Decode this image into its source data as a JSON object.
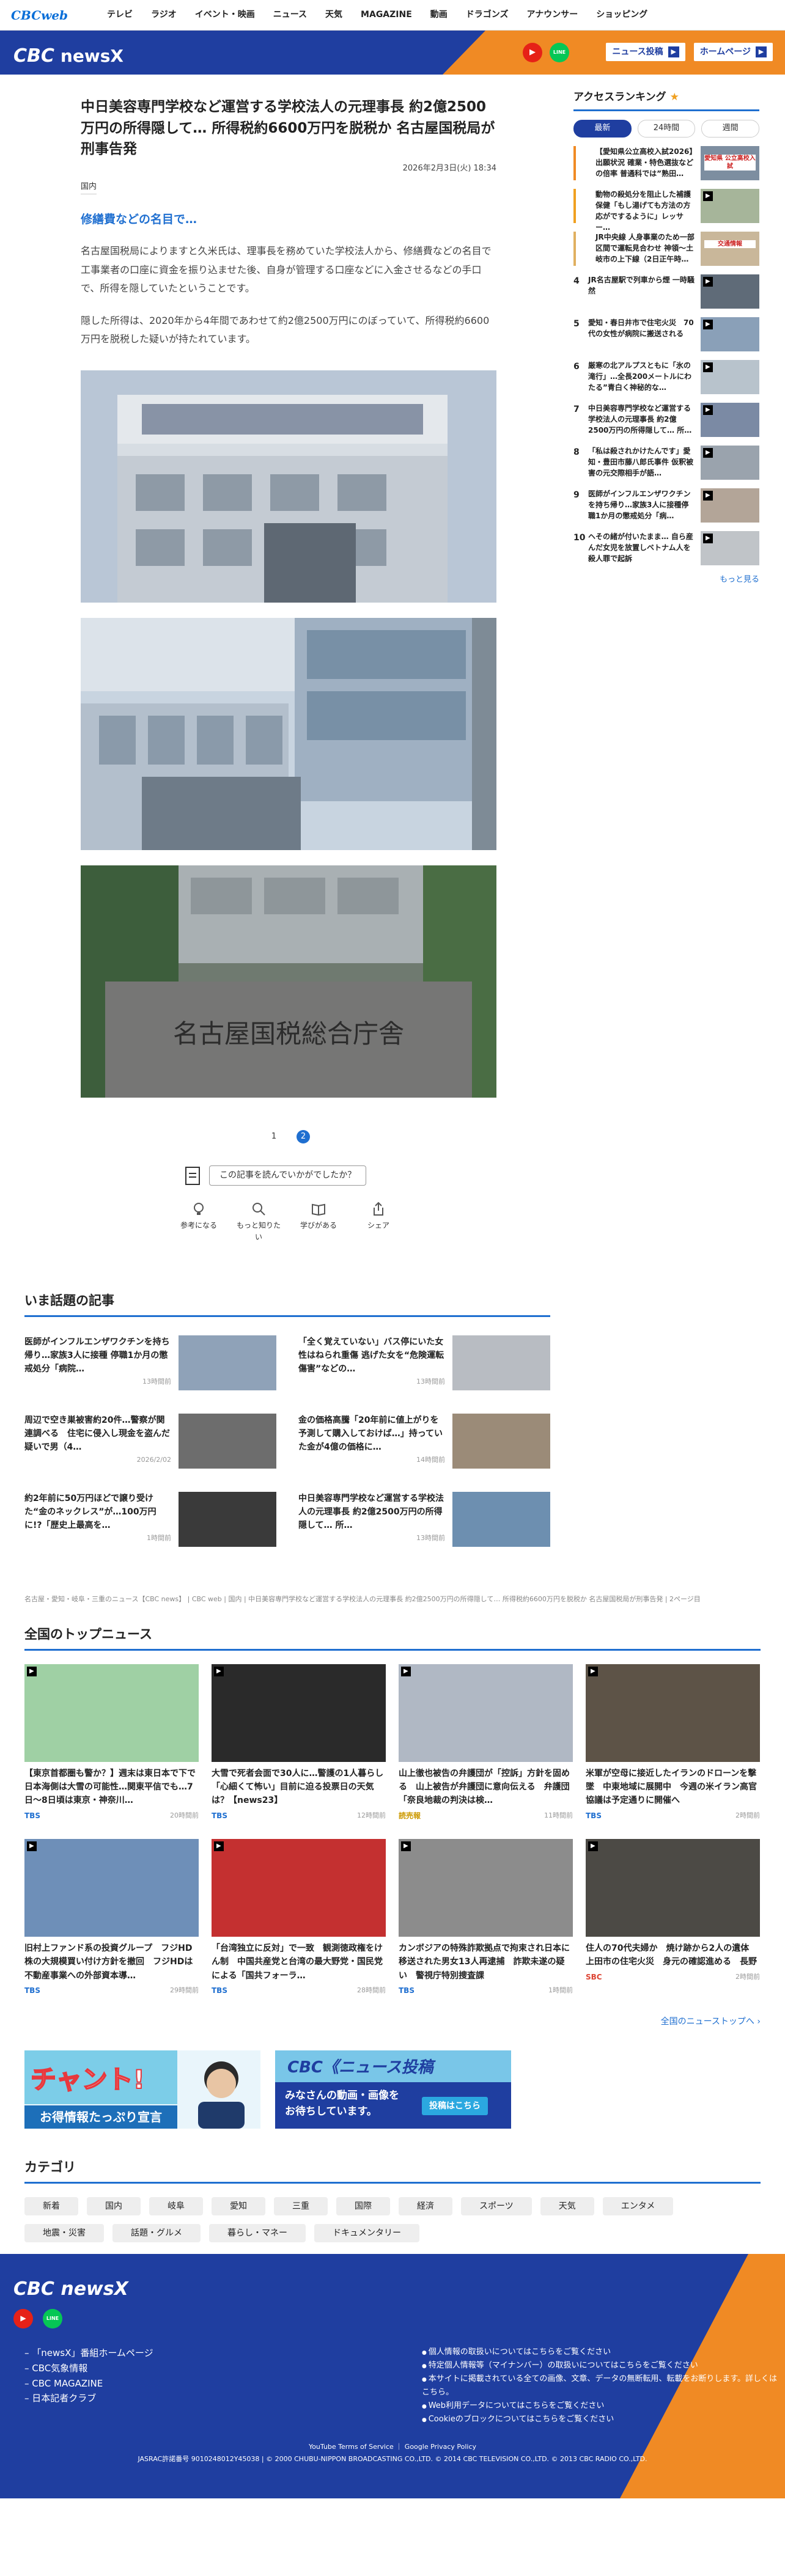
{
  "topnav": {
    "logo": "CBCweb",
    "items": [
      "テレビ",
      "ラジオ",
      "イベント・映画",
      "ニュース",
      "天気",
      "MAGAZINE",
      "動画",
      "ドラゴンズ",
      "アナウンサー",
      "ショッピング"
    ]
  },
  "header": {
    "logo": "CBC",
    "logo_sub": "newsX",
    "post_label": "ニュース投稿",
    "home_label": "ホームページ",
    "youtube": "▶",
    "line": "LINE"
  },
  "article": {
    "title": "中日美容専門学校など運営する学校法人の元理事長 約2億2500万円の所得隠して… 所得税約6600万円を脱税か 名古屋国税局が刑事告発",
    "date": "2026年2月3日(火) 18:34",
    "category": "国内",
    "subhead": "修繕費などの名目で…",
    "para1": "名古屋国税局によりますと久米氏は、理事長を務めていた学校法人から、修繕費などの名目で工事業者の口座に資金を振り込ませた後、自身が管理する口座などに入金させるなどの手口で、所得を隠していたということです。",
    "para2": "隠した所得は、2020年から4年間であわせて約2億2500万円にのぼっていて、所得税約6600万円を脱税した疑いが持たれています。",
    "photo3_text": "名古屋国税総合庁舎"
  },
  "pager": [
    "1",
    "2"
  ],
  "survey": {
    "question": "この記事を読んでいかがでしたか？",
    "reactions": [
      "参考になる",
      "もっと知りたい",
      "学びがある",
      "シェア"
    ]
  },
  "wadai": {
    "heading": "いま話題の記事",
    "items": [
      {
        "title": "医師がインフルエンザワクチンを持ち帰り…家族3人に接種 停職1か月の懲戒処分「病院…",
        "time": "13時間前"
      },
      {
        "title": "「全く覚えていない」バス停にいた女性はねられ重傷 逃げた女を“危険運転傷害”などの…",
        "time": "13時間前"
      },
      {
        "title": "周辺で空き巣被害約20件…警察が関連調べる　住宅に侵入し現金を盗んだ疑いで男（4…",
        "time": "2026/2/02"
      },
      {
        "title": "金の価格高騰「20年前に値上がりを予測して購入しておけば…」持っていた金が4億の価格に…",
        "time": "14時間前"
      },
      {
        "title": "約2年前に50万円ほどで譲り受けた“金のネックレス”が…100万円に!?「歴史上最高を…",
        "time": "1時間前"
      },
      {
        "title": "中日美容専門学校など運営する学校法人の元理事長 約2億2500万円の所得隠して… 所…",
        "time": "13時間前"
      }
    ]
  },
  "breadcrumb": "名古屋・愛知・岐阜・三重のニュース【CBC news】 | CBC web | 国内 | 中日美容専門学校など運営する学校法人の元理事長 約2億2500万円の所得隠して… 所得税約6600万円を脱税か 名古屋国税局が刑事告発 | 2ページ目",
  "national": {
    "heading": "全国のトップニュース",
    "more": "全国のニューストップへ",
    "items": [
      {
        "title": "【東京首都圏も警か？】週末は東日本で下で日本海側は大雪の可能性…関東平信でも…7日〜8日頃は東京・神奈川…",
        "src": "TBS",
        "time": "20時間前"
      },
      {
        "title": "大雪で死者会面で30人に…警護の1人暮らし「心細くて怖い」目前に迫る投票日の天気は？【news23】",
        "src": "TBS",
        "time": "12時間前"
      },
      {
        "title": "山上徹也被告の弁護団が「控訴」方針を固める　山上被告が弁護団に意向伝える　弁護団「奈良地裁の判決は検…",
        "src": "読売報",
        "time": "11時間前"
      },
      {
        "title": "米軍が空母に接近したイランのドローンを撃墜　中東地域に展開中　今週の米イラン高官協議は予定通りに開催へ",
        "src": "TBS",
        "time": "2時間前"
      },
      {
        "title": "旧村上ファンド系の投資グループ　フジHD株の大規模買い付け方針を撤回　フジHDは不動産事業への外部資本導…",
        "src": "TBS",
        "time": "29時間前"
      },
      {
        "title": "「台湾独立に反対」で一致　観測徳政権をけん制　中国共産党と台湾の最大野党・国民党による「国共フォーラ…",
        "src": "TBS",
        "time": "28時間前"
      },
      {
        "title": "カンボジアの特殊詐欺拠点で拘束され日本に移送された男女13人再逮捕　詐欺未遂の疑い　警視庁特別捜査課",
        "src": "TBS",
        "time": "1時間前"
      },
      {
        "title": "住人の70代夫婦か　焼け跡から2人の遺体　上田市の住宅火災　身元の確認進める　長野",
        "src": "SBC",
        "time": "2時間前"
      }
    ]
  },
  "banners": {
    "b1_main": "チャント!",
    "b1_sub": "お得情報たっぷり宣言",
    "b2_main": "CBC《ニュース投稿",
    "b2_sub1": "みなさんの動画・画像を",
    "b2_sub2": "お待ちしています。",
    "b2_btn": "投稿はこちら"
  },
  "categories": {
    "heading": "カテゴリ",
    "items": [
      "新着",
      "国内",
      "岐阜",
      "愛知",
      "三重",
      "国際",
      "経済",
      "スポーツ",
      "天気",
      "エンタメ",
      "地震・災害",
      "話題・グルメ",
      "暮らし・マネー",
      "ドキュメンタリー"
    ]
  },
  "ranking": {
    "heading": "アクセスランキング",
    "star": "★",
    "tabs": [
      "最新",
      "24時間",
      "週間"
    ],
    "items": [
      {
        "n": "",
        "title": "【愛知県公立高校入試2026】出願状況 確業・特色選抜などの倍率 普通科では”熟田…",
        "label": "愛知県 公立高校入試"
      },
      {
        "n": "",
        "title": "動物の殺処分を阻止した補護保健「もし湯げても方法の方応がでするように」レッサー…",
        "label": ""
      },
      {
        "n": "",
        "title": "JR中央線 人身事業のため一部区間で運転見合わせ 神領〜土岐市の上下線（2日正午時…",
        "label": "交通情報"
      },
      {
        "n": "4",
        "title": "JR名古屋駅で列車から煙 一時騒然",
        "label": ""
      },
      {
        "n": "5",
        "title": "愛知・春日井市で住宅火災　70代の女性が病院に搬送される",
        "label": ""
      },
      {
        "n": "6",
        "title": "厳寒の北アルプスともに「氷の滝行」…全長200メートルにわたる”青白く神秘的な…",
        "label": ""
      },
      {
        "n": "7",
        "title": "中日美容専門学校など運営する学校法人の元理事長 約2億2500万円の所得隠して… 所…",
        "label": ""
      },
      {
        "n": "8",
        "title": "「私は殺されかけたんです」愛知・豊田市藤八郎氏事件 仮釈被害の元交際相手が語…",
        "label": ""
      },
      {
        "n": "9",
        "title": "医師がインフルエンザワクチンを持ち帰り…家族3人に接種停職1か月の懲戒処分「病…",
        "label": ""
      },
      {
        "n": "10",
        "title": "ヘその緒が付いたまま… 自ら産んだ女児を放置しベトナム人を殺人罪で起訴",
        "label": ""
      }
    ],
    "more": "もっと見る"
  },
  "footer": {
    "logo": "CBC newsX",
    "links": [
      "「newsX」番組ホームページ",
      "CBC気象情報",
      "CBC MAGAZINE",
      "日本記者クラブ"
    ],
    "links2": [
      "個人情報の取扱いについてはこちらをご覧ください",
      "特定個人情報等（マイナンバー）の取扱いについてはこちらをご覧ください",
      "本サイトに掲載されている全ての画像、文章、データの無断転用、転載をお断りします。詳しくはこちら。",
      "Web利用データについてはこちらをご覧ください",
      "Cookieのブロックについてはこちらをご覧ください"
    ],
    "policy": "YouTube Terms of Service ｜ Google Privacy Policy",
    "jasrac": "JASRAC許諾番号 9010248012Y45038 | © 2000 CHUBU-NIPPON BROADCASTING CO.,LTD. © 2014 CBC TELEVISION CO.,LTD. © 2013 CBC RADIO CO.,LTD."
  }
}
